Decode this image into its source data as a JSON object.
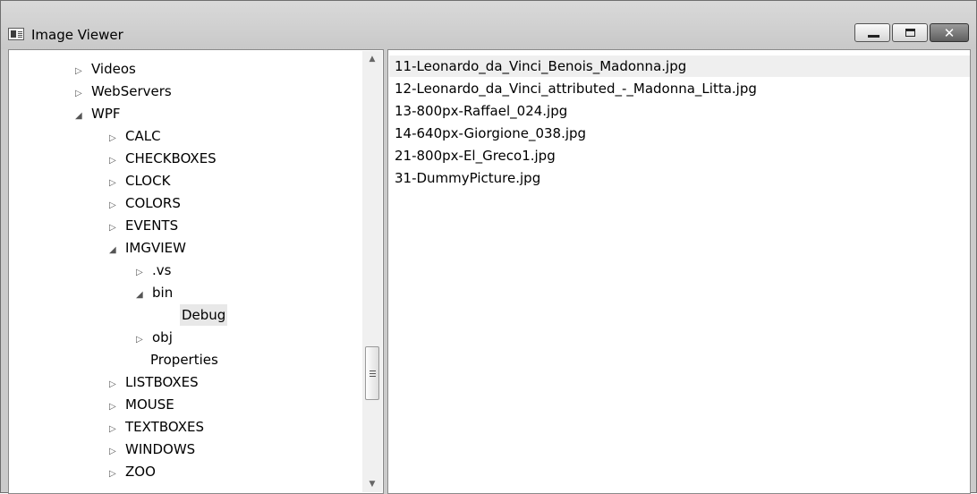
{
  "window": {
    "title": "Image Viewer",
    "icon": "image-viewer-app-icon",
    "buttons": {
      "minimize": "minimize-icon",
      "maximize": "maximize-icon",
      "close": "close-icon"
    }
  },
  "tree": {
    "items": [
      {
        "label": "Videos",
        "expander": "▷"
      },
      {
        "label": "WebServers",
        "expander": "▷"
      },
      {
        "label": "WPF",
        "expander": "◢"
      },
      {
        "label": "CALC",
        "expander": "▷"
      },
      {
        "label": "CHECKBOXES",
        "expander": "▷"
      },
      {
        "label": "CLOCK",
        "expander": "▷"
      },
      {
        "label": "COLORS",
        "expander": "▷"
      },
      {
        "label": "EVENTS",
        "expander": "▷"
      },
      {
        "label": "IMGVIEW",
        "expander": "◢"
      },
      {
        "label": ".vs",
        "expander": "▷"
      },
      {
        "label": "bin",
        "expander": "◢"
      },
      {
        "label": "Debug",
        "expander": ""
      },
      {
        "label": "obj",
        "expander": "▷"
      },
      {
        "label": "Properties",
        "expander": ""
      },
      {
        "label": "LISTBOXES",
        "expander": "▷"
      },
      {
        "label": "MOUSE",
        "expander": "▷"
      },
      {
        "label": "TEXTBOXES",
        "expander": "▷"
      },
      {
        "label": "WINDOWS",
        "expander": "▷"
      },
      {
        "label": "ZOO",
        "expander": "▷"
      }
    ],
    "selected": "Debug"
  },
  "files": {
    "items": [
      "11-Leonardo_da_Vinci_Benois_Madonna.jpg",
      "12-Leonardo_da_Vinci_attributed_-_Madonna_Litta.jpg",
      "13-800px-Raffael_024.jpg",
      "14-640px-Giorgione_038.jpg",
      "21-800px-El_Greco1.jpg",
      "31-DummyPicture.jpg"
    ],
    "highlighted": "11-Leonardo_da_Vinci_Benois_Madonna.jpg"
  }
}
